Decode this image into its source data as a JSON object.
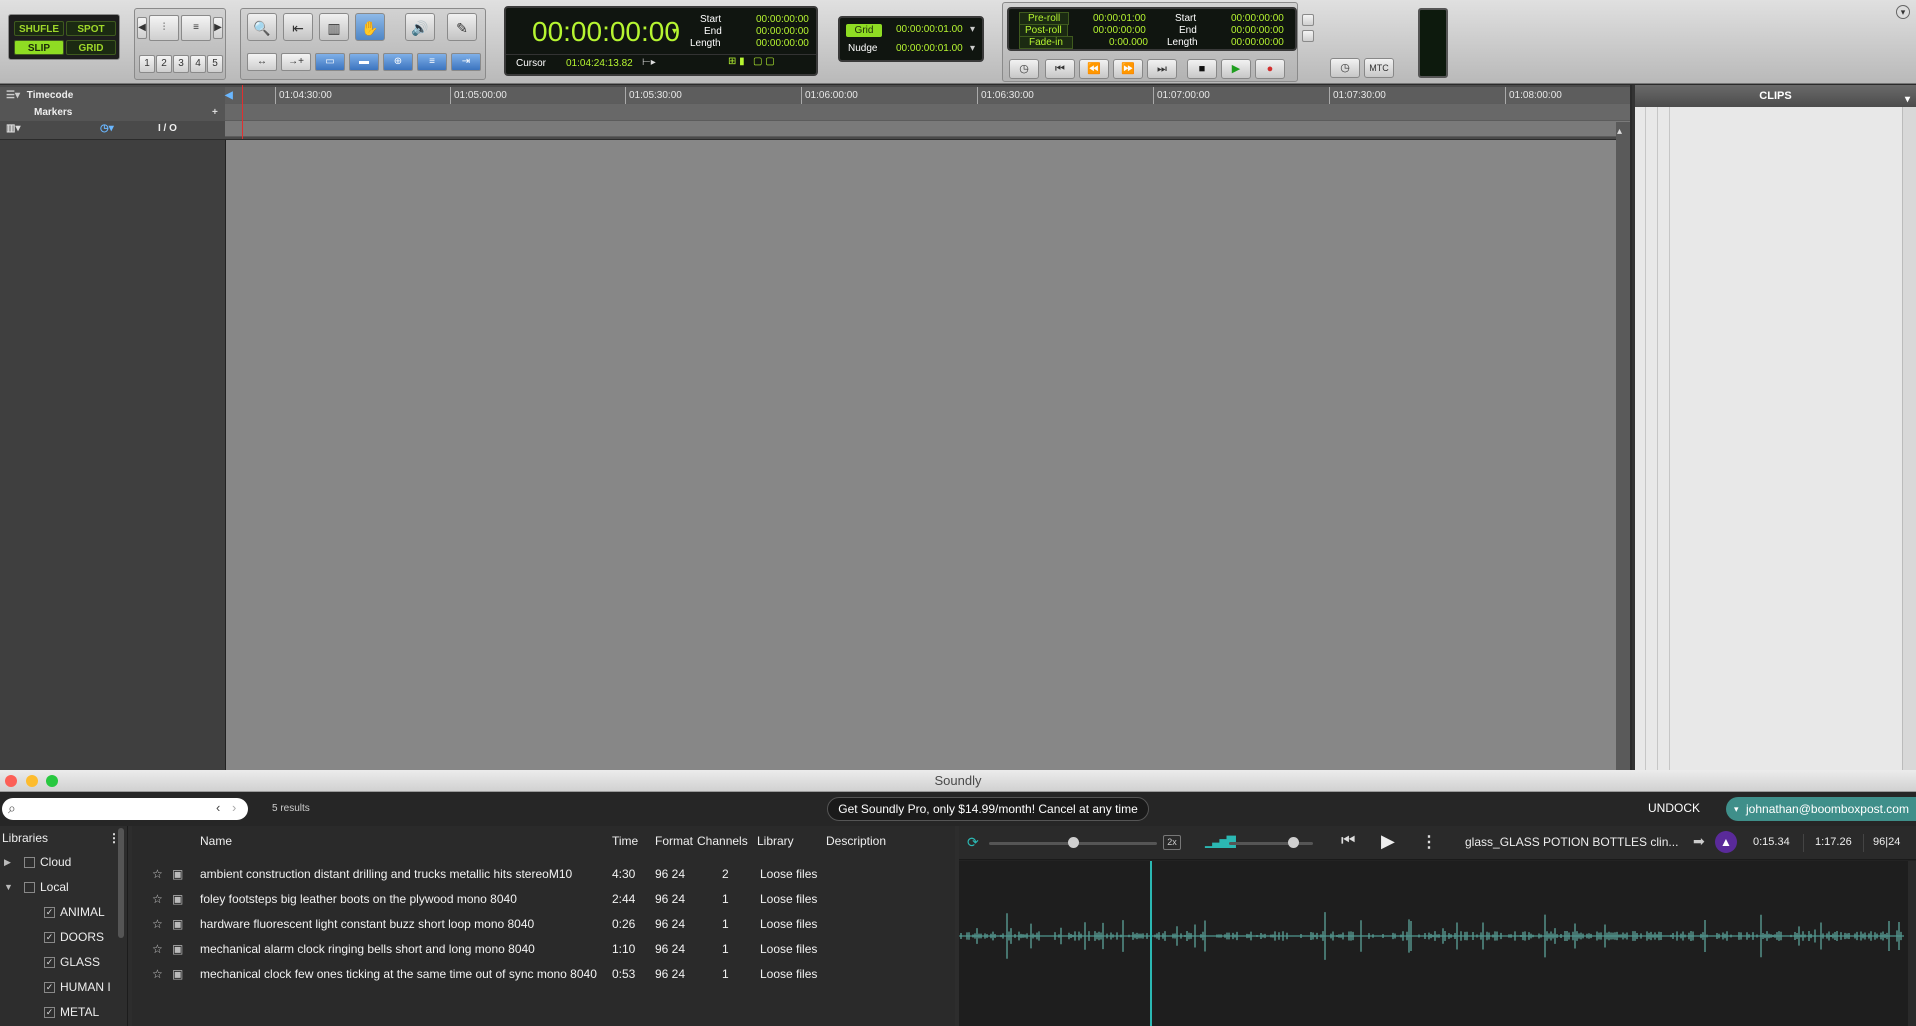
{
  "toolbar": {
    "edit_modes": [
      "SHUFLE",
      "SPOT",
      "SLIP",
      "GRID"
    ],
    "zoom_presets": [
      "1",
      "2",
      "3",
      "4",
      "5"
    ],
    "main_counter": "00:00:00:00",
    "sel_labels": {
      "start": "Start",
      "end": "End",
      "length": "Length"
    },
    "sel_values": {
      "start": "00:00:00:00",
      "end": "00:00:00:00",
      "length": "00:00:00:00"
    },
    "cursor_label": "Cursor",
    "cursor_value": "01:04:24:13.82",
    "grid_label": "Grid",
    "grid_value": "00:00:00:01.00",
    "nudge_label": "Nudge",
    "nudge_value": "00:00:00:01.00",
    "preroll_label": "Pre-roll",
    "preroll_value": "00:00:01:00",
    "postroll_label": "Post-roll",
    "postroll_value": "00:00:00:00",
    "fadein_label": "Fade-in",
    "fadein_value": "0:00.000",
    "tr_start_label": "Start",
    "tr_start_value": "00:00:00:00",
    "tr_end_label": "End",
    "tr_end_value": "00:00:00:00",
    "tr_length_label": "Length",
    "tr_length_value": "00:00:00:00",
    "mtc_label": "MTC"
  },
  "ruler": {
    "timecode_label": "Timecode",
    "markers_label": "Markers",
    "io_label": "I / O",
    "ticks": [
      "01:04:30:00",
      "01:05:00:00",
      "01:05:30:00",
      "01:06:00:00",
      "01:06:30:00",
      "01:07:00:00",
      "01:07:30:00",
      "01:08:00:00"
    ]
  },
  "clips": {
    "title": "CLIPS"
  },
  "soundly": {
    "window_title": "Soundly",
    "search_value": "",
    "results_count": "5 results",
    "promo": "Get Soundly Pro, only $14.99/month! Cancel at any time",
    "undock": "UNDOCK",
    "user": "johnathan@boomboxpost.com",
    "libraries_header": "Libraries",
    "libraries": [
      {
        "label": "Cloud",
        "level": 0,
        "checked": false,
        "arrow": "▶"
      },
      {
        "label": "Local",
        "level": 0,
        "checked": false,
        "arrow": "▼"
      },
      {
        "label": "ANIMAL",
        "level": 1,
        "checked": true,
        "arrow": ""
      },
      {
        "label": "DOORS",
        "level": 1,
        "checked": true,
        "arrow": ""
      },
      {
        "label": "GLASS",
        "level": 1,
        "checked": true,
        "arrow": ""
      },
      {
        "label": "HUMAN I",
        "level": 1,
        "checked": true,
        "arrow": ""
      },
      {
        "label": "METAL",
        "level": 1,
        "checked": true,
        "arrow": ""
      }
    ],
    "columns": [
      "Name",
      "Time",
      "Format",
      "Channels",
      "Library",
      "Description"
    ],
    "rows": [
      {
        "name": "ambient construction distant drilling and trucks metallic hits stereoM10",
        "time": "4:30",
        "format": "96 24",
        "channels": "2",
        "library": "Loose files",
        "description": ""
      },
      {
        "name": "foley footsteps big leather boots on the plywood mono 8040",
        "time": "2:44",
        "format": "96 24",
        "channels": "1",
        "library": "Loose files",
        "description": ""
      },
      {
        "name": "hardware fluorescent light constant buzz short loop mono 8040",
        "time": "0:26",
        "format": "96 24",
        "channels": "1",
        "library": "Loose files",
        "description": ""
      },
      {
        "name": "mechanical alarm clock ringing bells short and long mono 8040",
        "time": "1:10",
        "format": "96 24",
        "channels": "1",
        "library": "Loose files",
        "description": ""
      },
      {
        "name": "mechanical clock few ones ticking at the same time out of sync mono 8040",
        "time": "0:53",
        "format": "96 24",
        "channels": "1",
        "library": "Loose files",
        "description": ""
      }
    ],
    "player": {
      "speed": "2x",
      "file_name": "glass_GLASS POTION BOTTLES clin...",
      "position": "0:15.34",
      "duration": "1:17.26",
      "format": "96|24",
      "playhead_fraction": 0.2,
      "pitch_level": 0.5,
      "volume_level": 0.76
    }
  },
  "colors": {
    "lcd_green": "#b6f531",
    "accent_teal": "#2bb8b3",
    "user_badge": "#3f8f8a",
    "record_red": "#d32f2f"
  },
  "icons": [
    "search-icon",
    "star-icon",
    "disk-icon",
    "play-icon",
    "skip-back-icon",
    "more-icon",
    "loop-icon",
    "volume-icon",
    "drag-icon",
    "protools-icon",
    "zoom-icon",
    "trim-icon",
    "selector-icon",
    "grabber-icon",
    "scrubber-icon",
    "pencil-icon",
    "stop-icon",
    "record-icon",
    "rewind-icon",
    "forward-icon",
    "go-to-start-icon",
    "go-to-end-icon"
  ]
}
